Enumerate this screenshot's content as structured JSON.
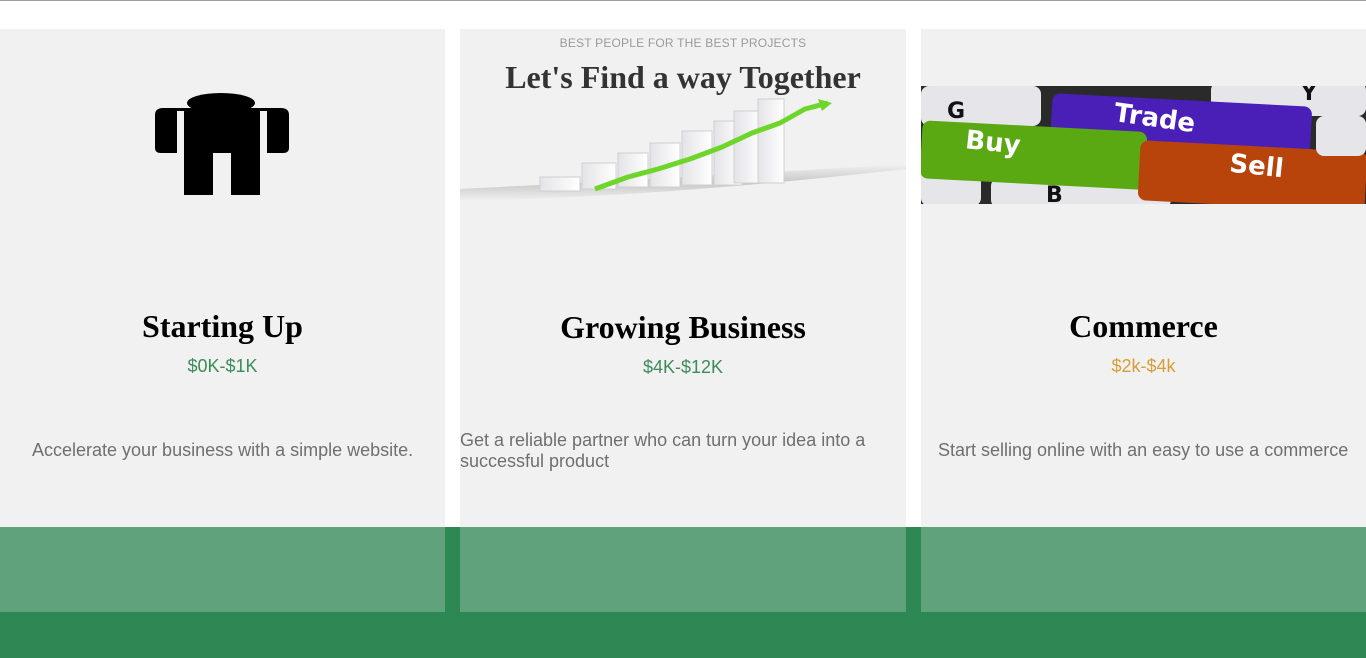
{
  "hero": {
    "eyebrow": "BEST PEOPLE FOR THE BEST PROJECTS",
    "headline": "Let's Find a way Together"
  },
  "trade_image_keys": {
    "key_g": "G",
    "key_y": "Y",
    "key_trade": "Trade",
    "key_buy": "Buy",
    "key_sell": "Sell",
    "key_b": "B"
  },
  "plans": [
    {
      "title": "Starting Up",
      "price": "$0K-$1K",
      "price_color": "#3c8c5a",
      "description": "Accelerate your business with a simple website.",
      "icon": "person-icon"
    },
    {
      "title": "Growing Business",
      "price": "$4K-$12K",
      "price_color": "#3c8c5a",
      "description": "Get a reliable partner who can turn your idea into a successful product",
      "icon": "growth-chart-icon"
    },
    {
      "title": "Commerce",
      "price": "$2k-$4k",
      "price_color": "#d79d3b",
      "description": "Start selling online with an easy to use a commerce",
      "icon": "trade-keyboard-image"
    }
  ],
  "colors": {
    "card_bg": "#f2f1f1",
    "footer_green": "#2e8853",
    "card_footer_green": "#5fa27b"
  }
}
